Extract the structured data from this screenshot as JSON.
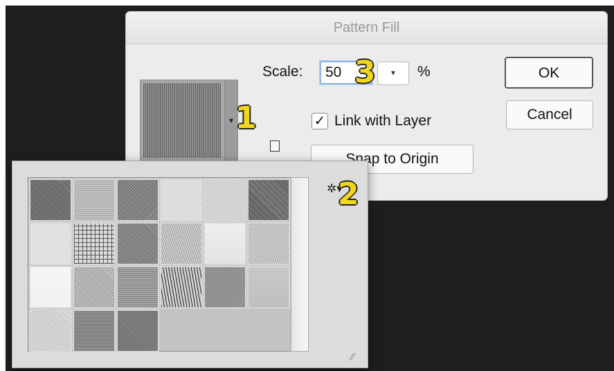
{
  "dialog": {
    "title": "Pattern Fill",
    "scale_label": "Scale:",
    "scale_value": "50",
    "scale_unit": "%",
    "link_label": "Link with Layer",
    "link_checked": true,
    "snap_label": "Snap to Origin",
    "ok_label": "OK",
    "cancel_label": "Cancel"
  },
  "annotations": {
    "one": "1",
    "two": "2",
    "three": "3"
  },
  "icons": {
    "dropdown": "▾",
    "check": "✓",
    "gear": "✲▾",
    "resize": "⁄⁄"
  },
  "patterns": [
    {
      "name": "pattern-1"
    },
    {
      "name": "pattern-2"
    },
    {
      "name": "pattern-3"
    },
    {
      "name": "pattern-4"
    },
    {
      "name": "pattern-5"
    },
    {
      "name": "pattern-6"
    },
    {
      "name": "pattern-7"
    },
    {
      "name": "pattern-8"
    },
    {
      "name": "pattern-9"
    },
    {
      "name": "pattern-10"
    },
    {
      "name": "pattern-11"
    },
    {
      "name": "pattern-12"
    },
    {
      "name": "pattern-13"
    },
    {
      "name": "pattern-14"
    },
    {
      "name": "pattern-15"
    },
    {
      "name": "pattern-16"
    },
    {
      "name": "pattern-17"
    },
    {
      "name": "pattern-18"
    },
    {
      "name": "pattern-19"
    },
    {
      "name": "pattern-20"
    },
    {
      "name": "pattern-21"
    }
  ],
  "colors": {
    "backdrop": "#1e1e1e",
    "badge": "#f2d61e",
    "focus": "#7aa4d6"
  }
}
